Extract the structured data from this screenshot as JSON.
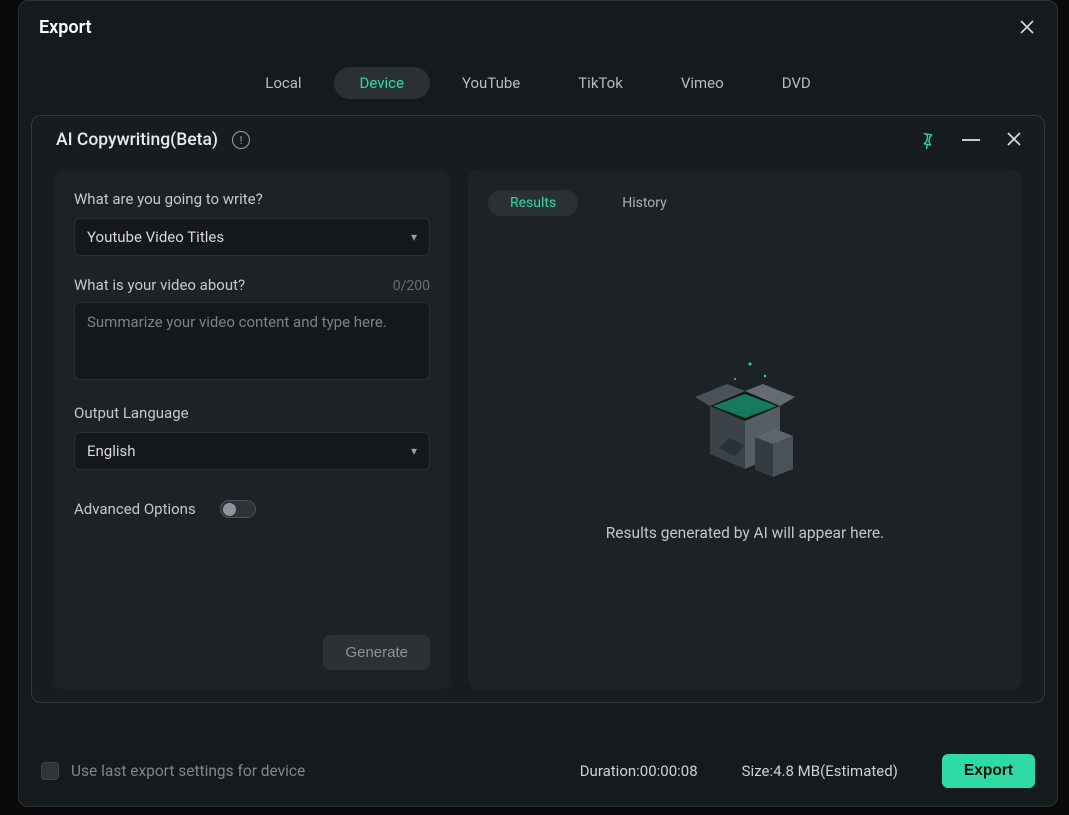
{
  "dialog": {
    "title": "Export"
  },
  "tabs": {
    "items": [
      "Local",
      "Device",
      "YouTube",
      "TikTok",
      "Vimeo",
      "DVD"
    ],
    "active_index": 1
  },
  "ai": {
    "title": "AI Copywriting(Beta)",
    "write_label": "What are you going to write?",
    "write_value": "Youtube Video Titles",
    "about_label": "What is your video about?",
    "about_counter": "0/200",
    "about_placeholder": "Summarize your video content and type here.",
    "about_value": "",
    "lang_label": "Output Language",
    "lang_value": "English",
    "advanced_label": "Advanced Options",
    "advanced_on": false,
    "generate_label": "Generate",
    "result_tabs": {
      "results": "Results",
      "history": "History",
      "active": "results"
    },
    "empty_text": "Results generated by AI will appear here."
  },
  "footer": {
    "checkbox_label": "Use last export settings for device",
    "duration": "Duration:00:00:08",
    "size": "Size:4.8 MB(Estimated)",
    "export_label": "Export"
  },
  "icons": {
    "close": "close-icon",
    "info": "info-icon",
    "pin": "pin-icon",
    "minimize": "minimize-icon",
    "chevron": "chevron-down-icon"
  }
}
